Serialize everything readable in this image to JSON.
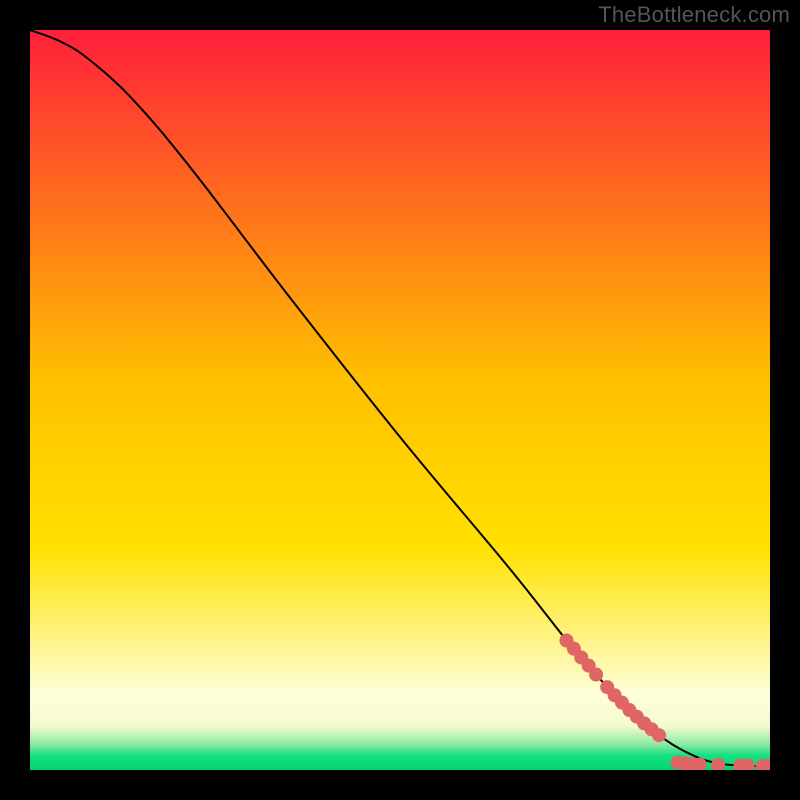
{
  "watermark": "TheBottleneck.com",
  "gradient": {
    "top": "#ff1f3a",
    "mid": "#ffe100",
    "cream": "#fdfeda",
    "green": "#18e082",
    "bottom": "#04d46e"
  },
  "chart_data": {
    "type": "line",
    "title": "",
    "xlabel": "",
    "ylabel": "",
    "xlim": [
      0,
      100
    ],
    "ylim": [
      0,
      100
    ],
    "curve": [
      {
        "x": 0,
        "y": 100
      },
      {
        "x": 4,
        "y": 98.5
      },
      {
        "x": 8,
        "y": 96.0
      },
      {
        "x": 14,
        "y": 90.5
      },
      {
        "x": 22,
        "y": 81.0
      },
      {
        "x": 35,
        "y": 64.0
      },
      {
        "x": 50,
        "y": 45.0
      },
      {
        "x": 65,
        "y": 27.0
      },
      {
        "x": 75,
        "y": 14.5
      },
      {
        "x": 82,
        "y": 7.5
      },
      {
        "x": 86,
        "y": 4.0
      },
      {
        "x": 90,
        "y": 1.8
      },
      {
        "x": 93,
        "y": 0.9
      },
      {
        "x": 96,
        "y": 0.6
      },
      {
        "x": 100,
        "y": 0.5
      }
    ],
    "highlight_points": [
      {
        "x": 72.5,
        "y": 17.5
      },
      {
        "x": 73.5,
        "y": 16.4
      },
      {
        "x": 74.5,
        "y": 15.2
      },
      {
        "x": 75.5,
        "y": 14.1
      },
      {
        "x": 76.5,
        "y": 12.9
      },
      {
        "x": 78.0,
        "y": 11.2
      },
      {
        "x": 79.0,
        "y": 10.1
      },
      {
        "x": 80.0,
        "y": 9.1
      },
      {
        "x": 81.0,
        "y": 8.1
      },
      {
        "x": 82.0,
        "y": 7.2
      },
      {
        "x": 83.0,
        "y": 6.3
      },
      {
        "x": 84.0,
        "y": 5.5
      },
      {
        "x": 85.0,
        "y": 4.7
      },
      {
        "x": 87.5,
        "y": 1.0
      },
      {
        "x": 88.5,
        "y": 0.9
      },
      {
        "x": 89.5,
        "y": 0.8
      },
      {
        "x": 90.5,
        "y": 0.75
      },
      {
        "x": 93.0,
        "y": 0.7
      },
      {
        "x": 96.0,
        "y": 0.6
      },
      {
        "x": 97.0,
        "y": 0.6
      },
      {
        "x": 99.0,
        "y": 0.55
      },
      {
        "x": 100.0,
        "y": 0.55
      }
    ],
    "marker_color": "#e06666",
    "marker_radius": 7
  }
}
